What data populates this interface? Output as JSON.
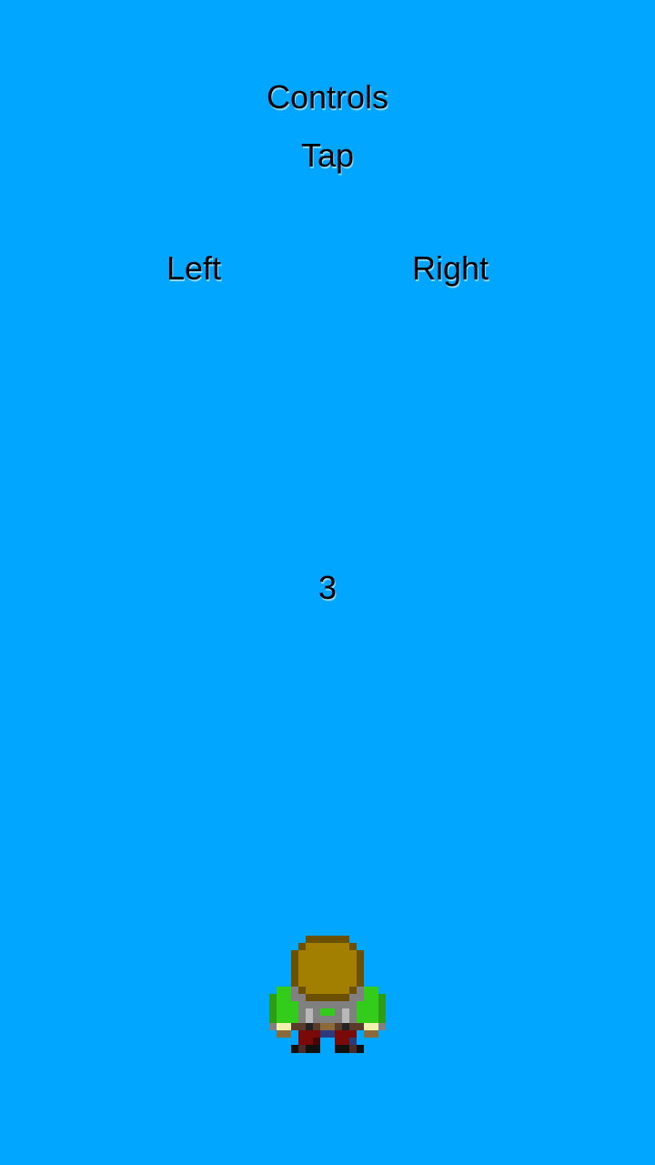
{
  "screen": {
    "background_color": "#00A6FF"
  },
  "controls": {
    "title": "Controls",
    "instruction": "Tap",
    "left_label": "Left",
    "right_label": "Right"
  },
  "countdown": {
    "value": "3"
  },
  "player": {
    "icon": "player-character-icon",
    "colors": {
      "hat": "#A37F00",
      "hat_outline": "#6B5000",
      "jacket": "#33CC1A",
      "body": "#808080",
      "pants": "#7A0A0A"
    }
  }
}
